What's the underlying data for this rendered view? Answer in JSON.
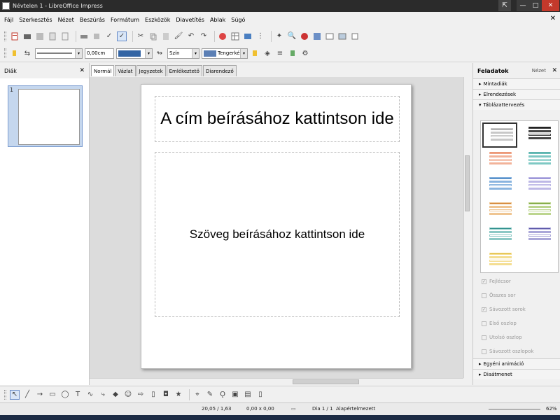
{
  "window": {
    "title": "Névtelen 1 - LibreOffice Impress",
    "controls": {
      "help": "⇱",
      "minimize": "—",
      "maximize": "□",
      "close": "✕"
    }
  },
  "menu": [
    "Fájl",
    "Szerkesztés",
    "Nézet",
    "Beszúrás",
    "Formátum",
    "Eszközök",
    "Diavetítés",
    "Ablak",
    "Súgó"
  ],
  "menu_close": "✕",
  "line_toolbar": {
    "line_width": "0,00cm",
    "area_style": "Szín",
    "area_color": "Tengerkék"
  },
  "slides_pane": {
    "title": "Diák",
    "close": "✕",
    "slides": [
      {
        "number": "1"
      }
    ]
  },
  "tabs": [
    "Normál",
    "Vázlat",
    "Jegyzetek",
    "Emlékeztető",
    "Diarendező"
  ],
  "slide": {
    "title_placeholder": "A cím beírásához kattintson ide",
    "body_placeholder": "Szöveg beírásához kattintson ide"
  },
  "tasks_pane": {
    "title": "Feladatok",
    "view": "Nézet",
    "close": "✕",
    "sections": [
      "Mintadiák",
      "Elrendezések",
      "Táblázattervezés"
    ],
    "options": [
      {
        "label": "Fejlécsor",
        "checked": true
      },
      {
        "label": "Összes sor",
        "checked": false
      },
      {
        "label": "Sávozott sorok",
        "checked": true
      },
      {
        "label": "Első oszlop",
        "checked": false
      },
      {
        "label": "Utolsó oszlop",
        "checked": false
      },
      {
        "label": "Sávozott oszlopok",
        "checked": false
      }
    ],
    "bottom_sections": [
      "Egyéni animáció",
      "Diaátmenet"
    ],
    "designs": [
      {
        "colors": [
          "#9a9a9a",
          "#c8c8c8"
        ]
      },
      {
        "colors": [
          "#111111",
          "#444444"
        ]
      },
      {
        "colors": [
          "#e2693c",
          "#f2b39a"
        ]
      },
      {
        "colors": [
          "#1f8f8a",
          "#7fc9c4"
        ]
      },
      {
        "colors": [
          "#2d6fb5",
          "#89b4df"
        ]
      },
      {
        "colors": [
          "#7d76c9",
          "#bdb8e6"
        ]
      },
      {
        "colors": [
          "#d0802f",
          "#efc592"
        ]
      },
      {
        "colors": [
          "#7aa33a",
          "#bcd58e"
        ]
      },
      {
        "colors": [
          "#2e8f8c",
          "#8cc8c5"
        ]
      },
      {
        "colors": [
          "#5a56a8",
          "#aaa7d8"
        ]
      },
      {
        "colors": [
          "#e0bb3c",
          "#f4de92"
        ]
      }
    ]
  },
  "status": {
    "position": "20,05 / 1,63",
    "size": "0,00 x 0,00",
    "slide": "Dia 1 / 1",
    "layout": "Alapértelmezett",
    "zoom": "62%"
  }
}
